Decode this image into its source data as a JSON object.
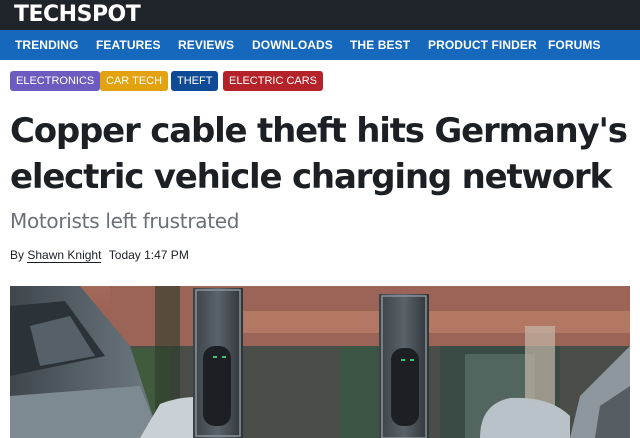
{
  "site": {
    "logo": "TECHSPOT"
  },
  "nav": {
    "items": [
      "TRENDING",
      "FEATURES",
      "REVIEWS",
      "DOWNLOADS",
      "THE BEST",
      "PRODUCT FINDER",
      "FORUMS"
    ]
  },
  "tags": [
    {
      "label": "ELECTRONICS",
      "color": "#6e5bbf"
    },
    {
      "label": "CAR TECH",
      "color": "#e3a20f"
    },
    {
      "label": "THEFT",
      "color": "#0f4a96"
    },
    {
      "label": "ELECTRIC CARS",
      "color": "#b4222a"
    }
  ],
  "article": {
    "title": "Copper cable theft hits Germany's electric vehicle charging network",
    "subtitle": "Motorists left frustrated",
    "byline_prefix": "By",
    "author": "Shawn Knight",
    "timestamp": "Today 1:47 PM"
  }
}
